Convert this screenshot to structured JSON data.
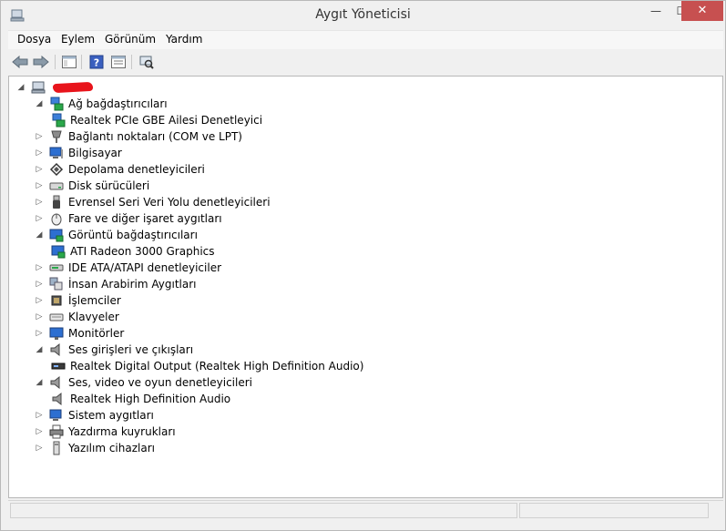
{
  "window": {
    "title": "Aygıt Yöneticisi",
    "minimize_glyph": "—",
    "maximize_glyph": "☐",
    "close_glyph": "✕"
  },
  "menu": {
    "items": [
      "Dosya",
      "Eylem",
      "Görünüm",
      "Yardım"
    ]
  },
  "toolbar": {
    "buttons": [
      "back-icon",
      "forward-icon",
      "console-tree-icon",
      "help-icon",
      "properties-icon",
      "scan-hardware-icon"
    ]
  },
  "tree": {
    "root_label": "",
    "root_label_redacted": true,
    "items": [
      {
        "label": "Ağ bağdaştırıcıları",
        "expanded": true,
        "icon": "network-adapter-icon"
      },
      {
        "label": "Realtek PCIe GBE Ailesi Denetleyici",
        "child": true,
        "icon": "network-adapter-icon"
      },
      {
        "label": "Bağlantı noktaları (COM ve LPT)",
        "icon": "port-icon"
      },
      {
        "label": "Bilgisayar",
        "icon": "computer-icon"
      },
      {
        "label": "Depolama denetleyicileri",
        "icon": "storage-icon"
      },
      {
        "label": "Disk sürücüleri",
        "icon": "disk-icon"
      },
      {
        "label": "Evrensel Seri Veri Yolu denetleyicileri",
        "icon": "usb-icon"
      },
      {
        "label": "Fare ve diğer işaret aygıtları",
        "icon": "mouse-icon"
      },
      {
        "label": "Görüntü bağdaştırıcıları",
        "expanded": true,
        "icon": "display-adapter-icon"
      },
      {
        "label": "ATI Radeon 3000 Graphics",
        "child": true,
        "icon": "display-adapter-icon"
      },
      {
        "label": "IDE ATA/ATAPI denetleyiciler",
        "icon": "ide-icon"
      },
      {
        "label": "İnsan Arabirim Aygıtları",
        "icon": "hid-icon"
      },
      {
        "label": "İşlemciler",
        "icon": "processor-icon"
      },
      {
        "label": "Klavyeler",
        "icon": "keyboard-icon"
      },
      {
        "label": "Monitörler",
        "icon": "monitor-icon"
      },
      {
        "label": "Ses girişleri ve çıkışları",
        "expanded": true,
        "icon": "speaker-icon"
      },
      {
        "label": "Realtek Digital Output (Realtek High Definition Audio)",
        "child": true,
        "icon": "audio-output-icon"
      },
      {
        "label": "Ses, video ve oyun denetleyicileri",
        "expanded": true,
        "icon": "speaker-icon"
      },
      {
        "label": "Realtek High Definition Audio",
        "child": true,
        "icon": "speaker-icon"
      },
      {
        "label": "Sistem aygıtları",
        "icon": "system-device-icon"
      },
      {
        "label": "Yazdırma kuyrukları",
        "icon": "printer-icon"
      },
      {
        "label": "Yazılım cihazları",
        "icon": "software-device-icon"
      }
    ]
  },
  "colors": {
    "close_button": "#c75050",
    "redaction": "#e8141b"
  }
}
